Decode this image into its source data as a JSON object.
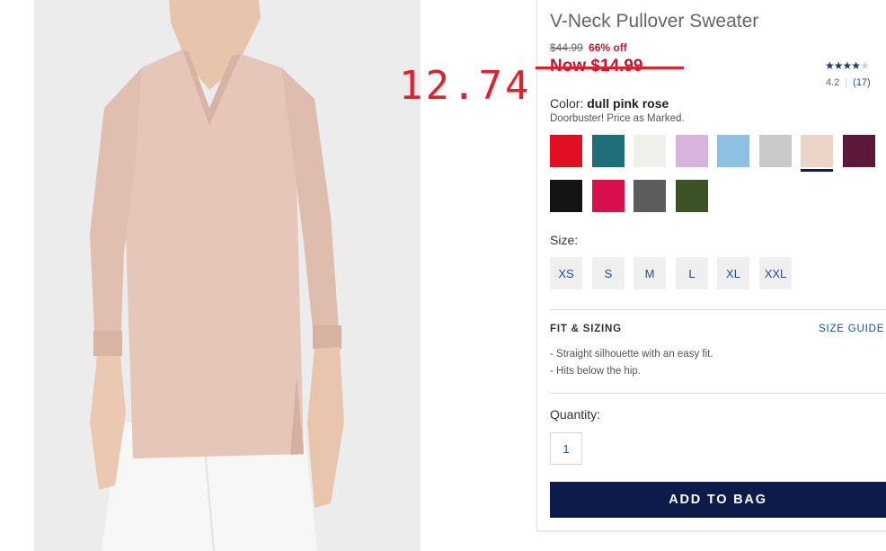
{
  "product": {
    "title": "V-Neck Pullover Sweater",
    "original_price": "$44.99",
    "discount": "66% off",
    "now_price": "Now $14.99",
    "handwritten_annotation": "12.74"
  },
  "rating": {
    "score": 4.2,
    "score_text": "4.2",
    "count_text": "(17)",
    "star_color": "#1d3a6b"
  },
  "color": {
    "label": "Color:",
    "selected_name": "dull pink rose",
    "promo": "Doorbuster! Price as Marked.",
    "swatches": [
      {
        "name": "red",
        "hex": "#e01022"
      },
      {
        "name": "teal",
        "hex": "#1f6e79"
      },
      {
        "name": "off-white",
        "hex": "#efefec"
      },
      {
        "name": "lavender",
        "hex": "#d8b4dd"
      },
      {
        "name": "light-blue",
        "hex": "#8ec0e3"
      },
      {
        "name": "light-gray",
        "hex": "#c9c9c9"
      },
      {
        "name": "dull-pink-rose",
        "hex": "#ecd4c8",
        "selected": true
      },
      {
        "name": "burgundy",
        "hex": "#5b1838"
      },
      {
        "name": "black",
        "hex": "#141414"
      },
      {
        "name": "pink",
        "hex": "#d8104e"
      },
      {
        "name": "charcoal",
        "hex": "#5c5c5c"
      },
      {
        "name": "olive",
        "hex": "#3d5128"
      }
    ]
  },
  "size": {
    "label": "Size:",
    "options": [
      "XS",
      "S",
      "M",
      "L",
      "XL",
      "XXL"
    ]
  },
  "fit": {
    "title": "FIT & SIZING",
    "size_guide": "SIZE GUIDE",
    "bullets": [
      "- Straight silhouette with an easy fit.",
      "- Hits below the hip."
    ]
  },
  "quantity": {
    "label": "Quantity:",
    "value": "1"
  },
  "actions": {
    "add_to_bag": "ADD TO BAG"
  },
  "colors": {
    "sale_red": "#c4172c",
    "annotation_red": "#e0202a",
    "button_navy": "#0c1b4a",
    "link_blue": "#1d4f91"
  }
}
